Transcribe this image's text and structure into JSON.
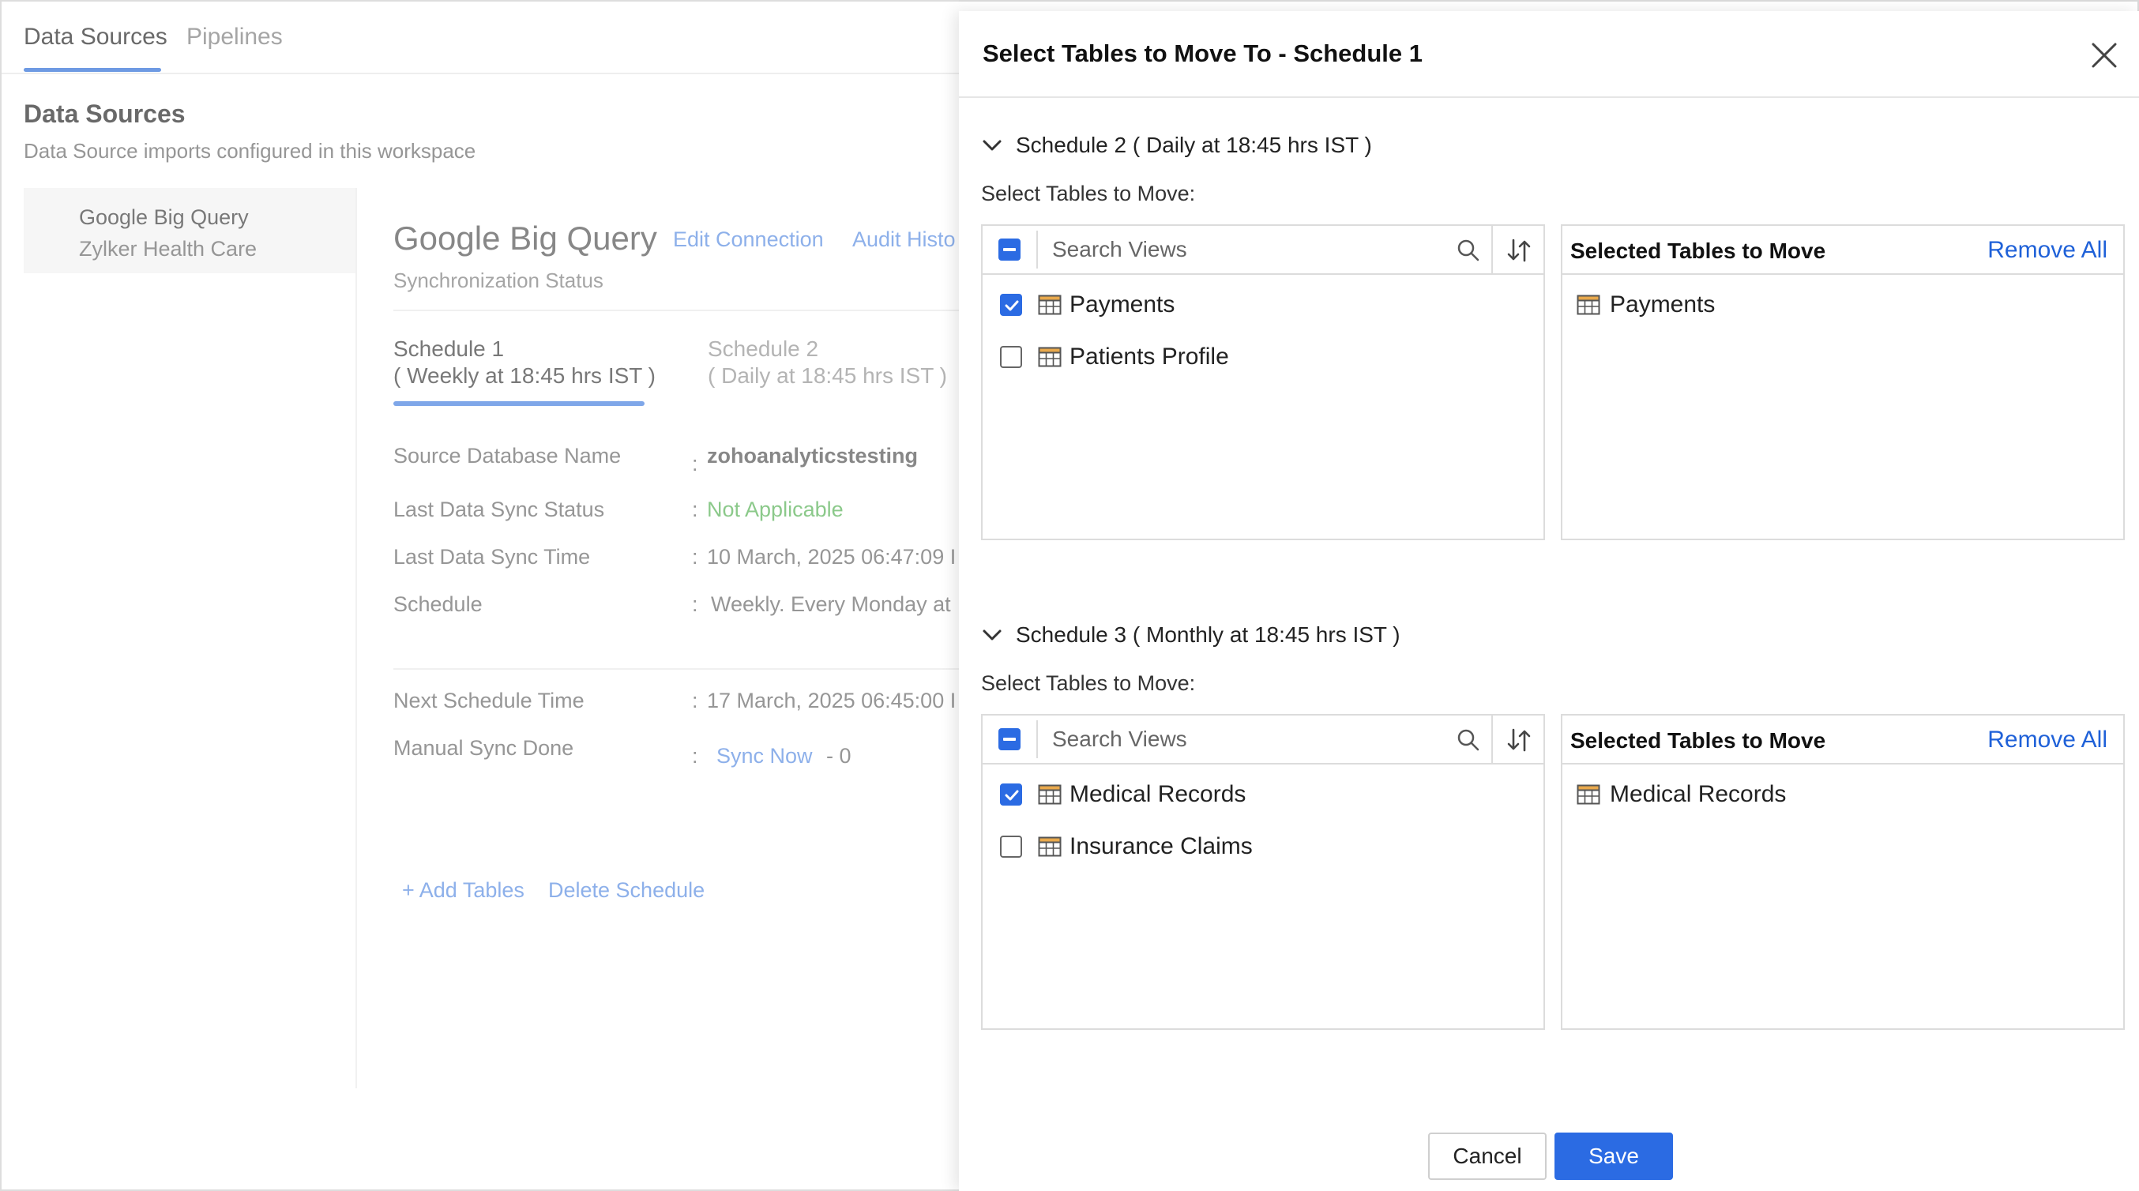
{
  "tabs": {
    "data_sources": "Data Sources",
    "pipelines": "Pipelines"
  },
  "section": {
    "title": "Data Sources",
    "subtitle": "Data Source imports configured in this workspace"
  },
  "datasource": {
    "name": "Google Big Query",
    "workspace": "Zylker Health Care"
  },
  "connection": {
    "title": "Google Big Query",
    "edit_label": "Edit Connection",
    "audit_label": "Audit Histo",
    "sync_status_label": "Synchronization Status"
  },
  "schedules": {
    "s1_name": "Schedule 1",
    "s1_desc": "( Weekly at 18:45 hrs IST )",
    "s2_name": "Schedule 2",
    "s2_desc": "( Daily at 18:45 hrs IST )"
  },
  "info": {
    "db_label": "Source Database Name",
    "db_value": "zohoanalyticstesting",
    "status_label": "Last Data Sync Status",
    "status_value": "Not Applicable",
    "time_label": "Last Data Sync Time",
    "time_value": "10 March, 2025 06:47:09 I",
    "schedule_label": "Schedule",
    "schedule_value": "Weekly. Every Monday at",
    "next_label": "Next Schedule Time",
    "next_value": "17 March, 2025 06:45:00 I",
    "manual_label": "Manual Sync Done",
    "sync_now": "Sync Now",
    "manual_count": "- 0",
    "colon": ":"
  },
  "actions": {
    "add_tables": "+ Add Tables",
    "delete_schedule": "Delete Schedule"
  },
  "dialog": {
    "title": "Select Tables to Move To - Schedule 1",
    "cancel_label": "Cancel",
    "save_label": "Save",
    "groups": [
      {
        "heading": "Schedule 2 ( Daily at 18:45 hrs IST )",
        "sub": "Select Tables to Move:",
        "search_placeholder": "Search Views",
        "tables": [
          {
            "name": "Payments",
            "checked": true
          },
          {
            "name": "Patients Profile",
            "checked": false
          }
        ],
        "selected_title": "Selected Tables to Move",
        "remove_all": "Remove All",
        "selected": [
          "Payments"
        ]
      },
      {
        "heading": "Schedule 3 ( Monthly at 18:45 hrs IST )",
        "sub": "Select Tables to Move:",
        "search_placeholder": "Search Views",
        "tables": [
          {
            "name": "Medical Records",
            "checked": true
          },
          {
            "name": "Insurance Claims",
            "checked": false
          }
        ],
        "selected_title": "Selected Tables to Move",
        "remove_all": "Remove All",
        "selected": [
          "Medical Records"
        ]
      }
    ]
  },
  "colors": {
    "accent": "#2b6be3",
    "link": "#1f61d8",
    "success": "#7cc27a",
    "table_icon": "#e9a94c"
  }
}
